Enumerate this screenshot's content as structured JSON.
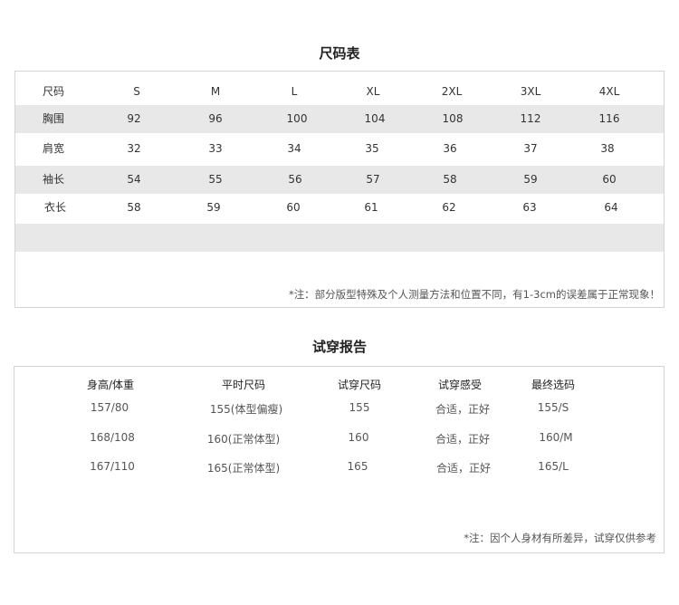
{
  "size_chart": {
    "title": "尺码表",
    "header": {
      "label": "尺码",
      "sizes": [
        "S",
        "M",
        "L",
        "XL",
        "2XL",
        "3XL",
        "4XL"
      ]
    },
    "rows": [
      {
        "label": "胸围",
        "values": [
          "92",
          "96",
          "100",
          "104",
          "108",
          "112",
          "116"
        ]
      },
      {
        "label": "肩宽",
        "values": [
          "32",
          "33",
          "34",
          "35",
          "36",
          "37",
          "38"
        ]
      },
      {
        "label": "袖长",
        "values": [
          "54",
          "55",
          "56",
          "57",
          "58",
          "59",
          "60"
        ]
      },
      {
        "label": "衣长",
        "values": [
          "58",
          "59",
          "60",
          "61",
          "62",
          "63",
          "64"
        ]
      }
    ],
    "note": "*注：部分版型特殊及个人测量方法和位置不同，有1-3cm的误差属于正常现象！"
  },
  "fit_report": {
    "title": "试穿报告",
    "headers": [
      "身高/体重",
      "平时尺码",
      "试穿尺码",
      "试穿感受",
      "最终选码"
    ],
    "rows": [
      [
        "157/80",
        "155(体型偏瘦)",
        "155",
        "合适，正好",
        "155/S"
      ],
      [
        "168/108",
        "160(正常体型)",
        "160",
        "合适，正好",
        "160/M"
      ],
      [
        "167/110",
        "165(正常体型)",
        "165",
        "合适，正好",
        "165/L"
      ]
    ],
    "note": "*注：因个人身材有所差异，试穿仅供参考"
  }
}
